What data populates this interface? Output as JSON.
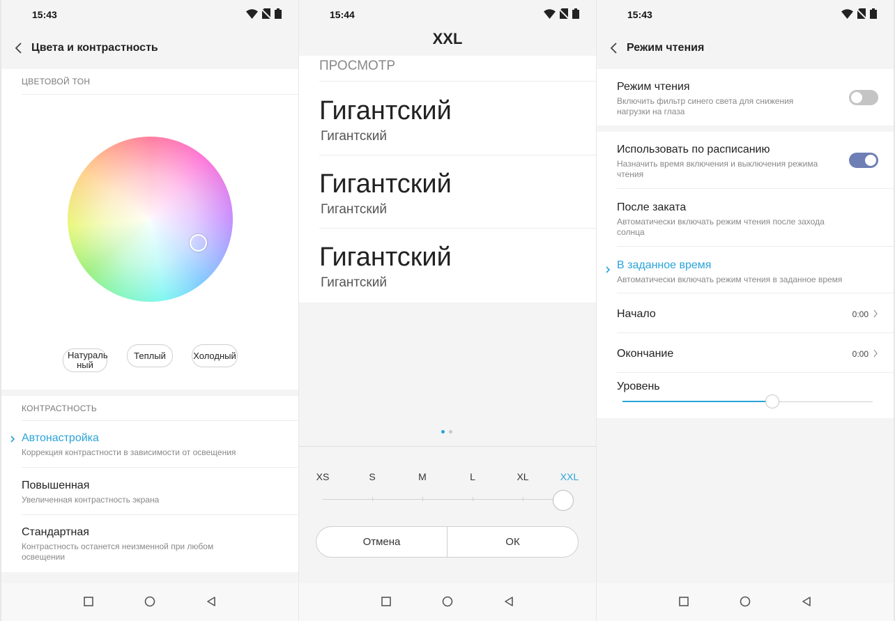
{
  "screen1": {
    "time": "15:43",
    "title": "Цвета и контрастность",
    "section_tone": "ЦВЕТОВОЙ ТОН",
    "presets": [
      {
        "label": "Натураль ный"
      },
      {
        "label": "Теплый"
      },
      {
        "label": "Холодный"
      }
    ],
    "section_contrast": "КОНТРАСТНОСТЬ",
    "items": [
      {
        "title": "Автонастройка",
        "desc": "Коррекция контрастности в зависимости от освещения",
        "selected": true
      },
      {
        "title": "Повышенная",
        "desc": "Увеличенная контрастность экрана",
        "selected": false
      },
      {
        "title": "Стандартная",
        "desc": "Контрастность останется неизменной при любом освещении",
        "selected": false
      }
    ]
  },
  "screen2": {
    "time": "15:44",
    "title": "XXL",
    "preview_label": "ПРОСМОТР",
    "previews": [
      {
        "big": "Гигантский",
        "small": "Гигантский"
      },
      {
        "big": "Гигантский",
        "small": "Гигантский"
      },
      {
        "big": "Гигантский",
        "small": "Гигантский"
      }
    ],
    "sizes": [
      "XS",
      "S",
      "M",
      "L",
      "XL",
      "XXL"
    ],
    "selected_size": "XXL",
    "cancel_label": "Отмена",
    "ok_label": "ОК"
  },
  "screen3": {
    "time": "15:43",
    "title": "Режим чтения",
    "reading_mode": {
      "title": "Режим чтения",
      "desc": "Включить фильтр синего света для снижения нагрузки на глаза",
      "on": false
    },
    "schedule": {
      "title": "Использовать по расписанию",
      "desc": "Назначить время включения и выключения режима чтения",
      "on": true
    },
    "sunset": {
      "title": "После заката",
      "desc": "Автоматически включать режим чтения после захода солнца"
    },
    "custom": {
      "title": "В заданное время",
      "desc": "Автоматически включать режим чтения в заданное время"
    },
    "start": {
      "label": "Начало",
      "value": "0:00"
    },
    "end": {
      "label": "Окончание",
      "value": "0:00"
    },
    "level": {
      "label": "Уровень",
      "fraction": 0.6
    }
  },
  "colors": {
    "accent": "#2aa3d9",
    "toggle_on": "#6e7fb5",
    "toggle_off": "#c4c4c4"
  },
  "icons": {
    "status": [
      "wifi-icon",
      "no-sim-icon",
      "battery-icon"
    ],
    "nav": [
      "recents-icon",
      "home-icon",
      "back-nav-icon"
    ]
  }
}
